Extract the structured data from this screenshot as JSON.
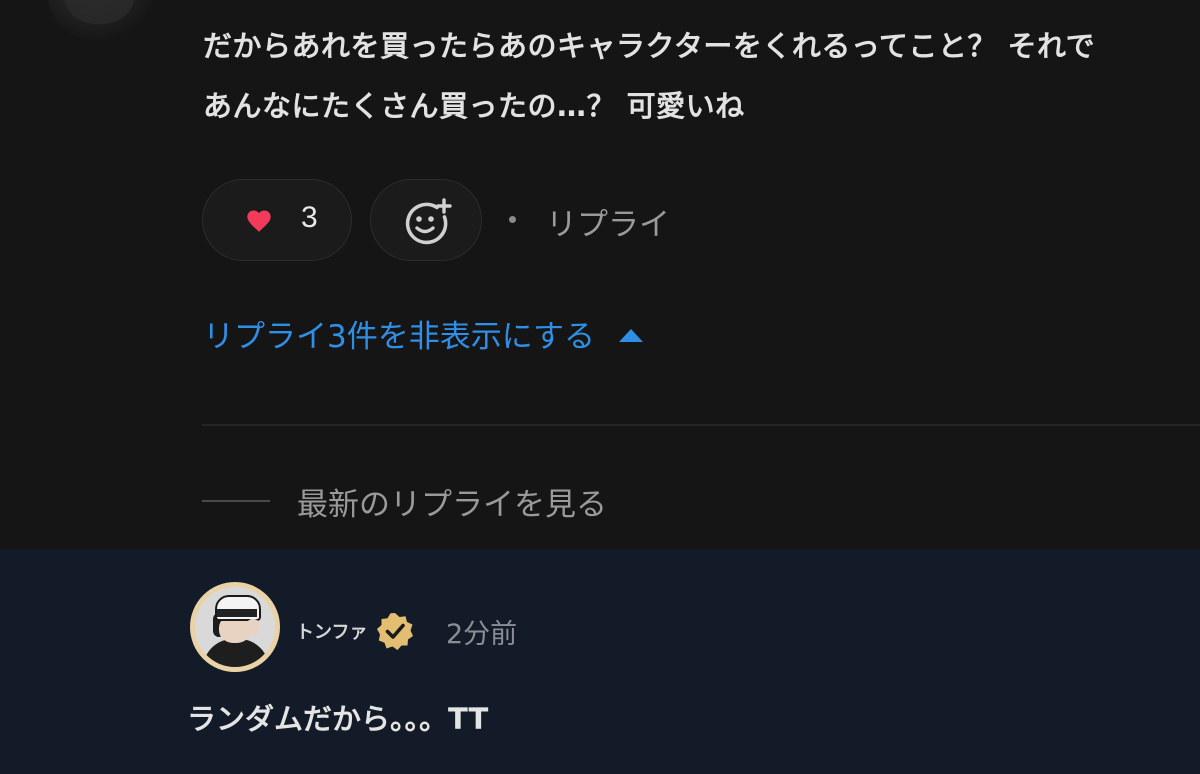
{
  "comment": {
    "lines": [
      "だからあれを買ったらあのキャラクターをくれるってこと？ それで",
      "あんなにたくさん買ったの…？ 可愛いね"
    ],
    "like_count": "3",
    "reply_label": "リプライ",
    "hide_replies_label": "リプライ3件を非表示にする",
    "avatar_icon": "user-avatar",
    "heart_icon": "heart-icon",
    "react_icon": "add-reaction-icon"
  },
  "latest_replies_label": "最新のリプライを見る",
  "reply": {
    "username": "トンファ",
    "timestamp": "2分前",
    "text": "ランダムだから。。。TT",
    "verified_icon": "verified-badge-icon"
  },
  "colors": {
    "background_top": "#151515",
    "background_bottom": "#121b27",
    "link_blue": "#2f8fe6",
    "heart_red": "#f23b5a",
    "badge_gold": "#e2bd72"
  }
}
